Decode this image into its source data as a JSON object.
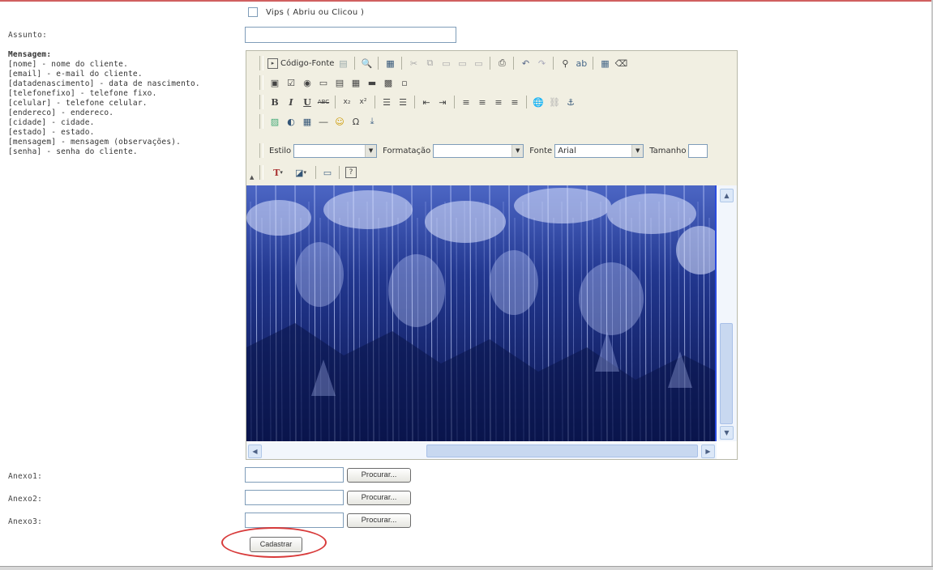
{
  "vips": {
    "label": "Vips ( Abriu ou Clicou )"
  },
  "subject": {
    "label": "Assunto:",
    "value": ""
  },
  "message": {
    "title": "Mensagem:",
    "tags": [
      "[nome] - nome do cliente.",
      "[email] - e-mail do cliente.",
      "[datadenascimento] - data de nascimento.",
      "[telefonefixo] - telefone fixo.",
      "[celular] - telefone celular.",
      "[endereco] - endereco.",
      "[cidade] - cidade.",
      "[estado] - estado.",
      "[mensagem] - mensagem (observações).",
      "[senha] - senha do cliente."
    ]
  },
  "editor": {
    "source_label": "Código-Fonte",
    "style_label": "Estilo",
    "format_label": "Formatação",
    "font_label": "Fonte",
    "font_value": "Arial",
    "size_label": "Tamanho",
    "style_value": "",
    "format_value": ""
  },
  "attachments": [
    {
      "label": "Anexo1:",
      "button": "Procurar..."
    },
    {
      "label": "Anexo2:",
      "button": "Procurar..."
    },
    {
      "label": "Anexo3:",
      "button": "Procurar..."
    }
  ],
  "submit": {
    "label": "Cadastrar"
  },
  "colors": {
    "highlight": "#d83a3a",
    "photo_blue": "#1a2f7a"
  }
}
